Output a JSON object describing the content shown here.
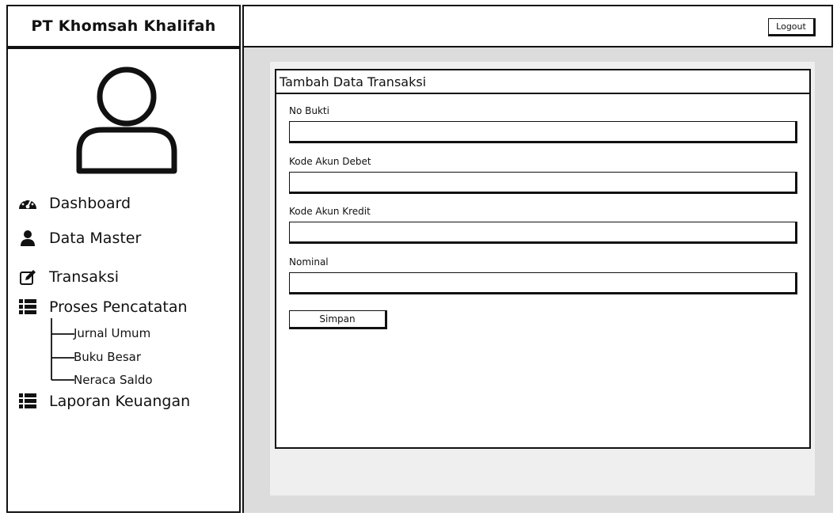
{
  "header": {
    "brand": "PT Khomsah Khalifah",
    "logout_label": "Logout"
  },
  "sidebar": {
    "items": [
      {
        "label": "Dashboard",
        "icon": "dashboard-icon"
      },
      {
        "label": "Data Master",
        "icon": "user-icon"
      },
      {
        "label": "Transaksi",
        "icon": "edit-icon"
      },
      {
        "label": "Proses Pencatatan",
        "icon": "list-icon"
      },
      {
        "label": "Laporan Keuangan",
        "icon": "list-icon"
      }
    ],
    "subitems": [
      {
        "label": "Jurnal Umum"
      },
      {
        "label": "Buku Besar"
      },
      {
        "label": "Neraca Saldo"
      }
    ]
  },
  "form": {
    "title": "Tambah Data Transaksi",
    "fields": [
      {
        "label": "No Bukti",
        "value": ""
      },
      {
        "label": "Kode Akun Debet",
        "value": ""
      },
      {
        "label": "Kode Akun Kredit",
        "value": ""
      },
      {
        "label": "Nominal",
        "value": ""
      }
    ],
    "submit_label": "Simpan"
  }
}
